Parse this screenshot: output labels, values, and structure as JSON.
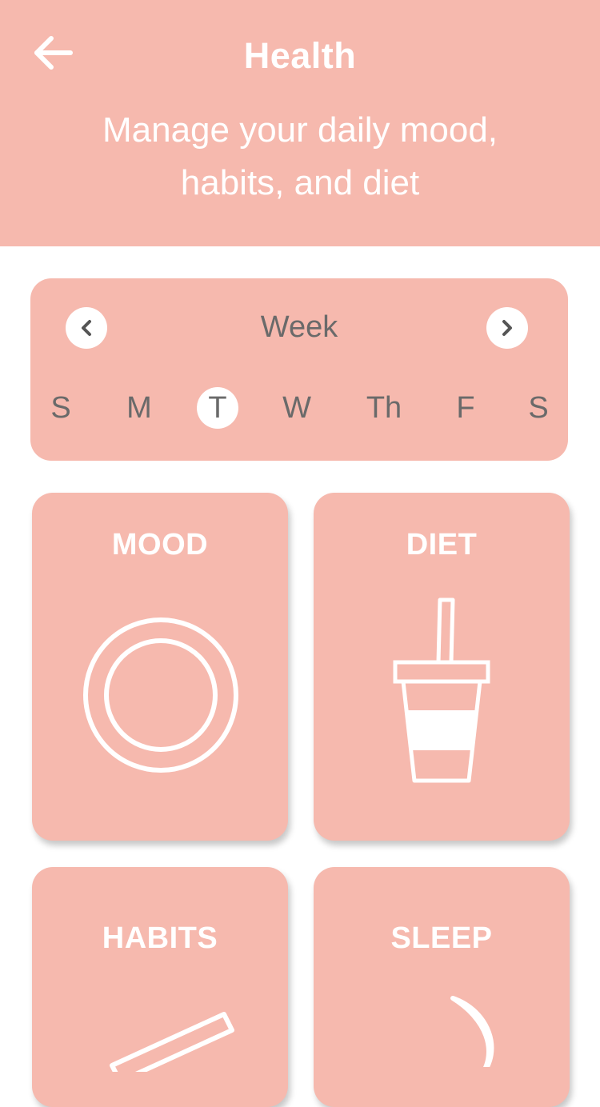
{
  "header": {
    "title": "Health",
    "subtitle_line1": "Manage your daily mood,",
    "subtitle_line2": "habits, and diet",
    "back_icon": "arrow-left-icon",
    "background": "#f6b9ae"
  },
  "week": {
    "label": "Week",
    "prev_icon": "chevron-left-icon",
    "next_icon": "chevron-right-icon",
    "days": [
      {
        "label": "S",
        "selected": false
      },
      {
        "label": "M",
        "selected": false
      },
      {
        "label": "T",
        "selected": true
      },
      {
        "label": "W",
        "selected": false
      },
      {
        "label": "Th",
        "selected": false
      },
      {
        "label": "F",
        "selected": false
      },
      {
        "label": "S",
        "selected": false
      }
    ]
  },
  "tiles": [
    {
      "label": "MOOD",
      "icon": "plate-icon"
    },
    {
      "label": "DIET",
      "icon": "drink-cup-icon"
    },
    {
      "label": "HABITS",
      "icon": "pencil-icon"
    },
    {
      "label": "SLEEP",
      "icon": "moon-icon"
    }
  ],
  "colors": {
    "accent": "#f6b9ae",
    "text_dark": "#6a6a6a",
    "white": "#ffffff"
  }
}
